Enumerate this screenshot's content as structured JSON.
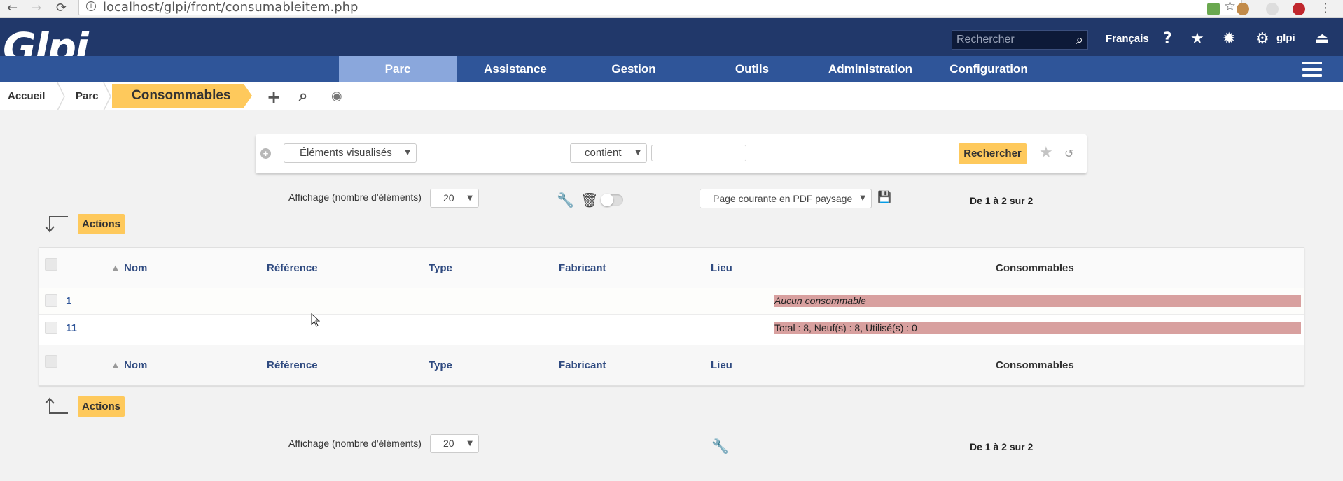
{
  "browser": {
    "url": "localhost/glpi/front/consumableitem.php",
    "back_icon": "←",
    "forward_icon": "→",
    "reload_icon": "⟳",
    "star_icon": "☆",
    "info_icon": "i",
    "menu_icon": "⋮"
  },
  "header": {
    "logo": "Glpi",
    "search_placeholder": "Rechercher",
    "language": "Français",
    "user": "glpi",
    "help_icon": "?",
    "star_icon": "★",
    "bug_icon": "✹",
    "gear_icon": "⚙",
    "logout_icon": "⏏",
    "search_icon": "⌕"
  },
  "menu": {
    "items": [
      "Parc",
      "Assistance",
      "Gestion",
      "Outils",
      "Administration",
      "Configuration"
    ],
    "active": "Parc"
  },
  "breadcrumb": {
    "items": [
      "Accueil",
      "Parc"
    ],
    "current": "Consommables",
    "add_icon": "+",
    "search_icon": "⌕",
    "view_icon": "◉"
  },
  "search": {
    "criteria_field": "Éléments visualisés",
    "operator": "contient",
    "value": "",
    "submit_label": "Rechercher",
    "save_icon": "★",
    "reset_icon": "↺",
    "add_icon": "+"
  },
  "pager_top": {
    "label": "Affichage (nombre d'éléments)",
    "per_page": "20",
    "export_option": "Page courante en PDF paysage",
    "range": "De 1 à 2 sur 2",
    "wrench_icon": "🔧",
    "trash_icon": "🗑",
    "save_icon": "💾"
  },
  "actions_label": "Actions",
  "table": {
    "columns": [
      "Nom",
      "Référence",
      "Type",
      "Fabricant",
      "Lieu",
      "Consommables"
    ],
    "sort_icon": "▲",
    "rows": [
      {
        "name": "1",
        "consumables": "Aucun consommable"
      },
      {
        "name": "11",
        "consumables": "Total : 8, Neuf(s) : 8, Utilisé(s) : 0"
      }
    ]
  },
  "pager_bottom": {
    "label": "Affichage (nombre d'éléments)",
    "per_page": "20",
    "range": "De 1 à 2 sur 2",
    "wrench_icon": "🔧"
  },
  "colors": {
    "header_bg": "#21386a",
    "menu_bg": "#2f5599",
    "menu_active": "#8aa7dc",
    "accent_yellow": "#fec95c",
    "badge_red": "#d8a09f"
  }
}
